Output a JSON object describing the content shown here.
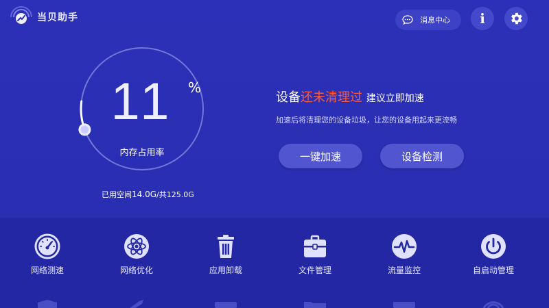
{
  "app": {
    "name": "当贝助手",
    "message_center_label": "消息中心",
    "info_label": "i"
  },
  "gauge": {
    "value": "11",
    "unit": "%",
    "label": "内存占用率",
    "fill_fraction": 0.11,
    "usage_prefix": "已用空间",
    "used": "14.0G",
    "separator": "/共",
    "total": "125.0G"
  },
  "status": {
    "prefix": "设备",
    "highlight": "还未清理过",
    "suffix": "建议立即加速",
    "subtitle": "加速后将清理您的设备垃圾，让您的设备用起来更流畅",
    "highlight_color": "#ff5a38"
  },
  "actions": {
    "accelerate_label": "一键加速",
    "detect_label": "设备检测"
  },
  "tools": [
    {
      "label": "网络测速",
      "icon": "speedometer-icon"
    },
    {
      "label": "网络优化",
      "icon": "atom-icon"
    },
    {
      "label": "应用卸载",
      "icon": "trash-icon"
    },
    {
      "label": "文件管理",
      "icon": "briefcase-icon"
    },
    {
      "label": "流量监控",
      "icon": "pulse-icon"
    },
    {
      "label": "自启动管理",
      "icon": "power-icon"
    }
  ]
}
